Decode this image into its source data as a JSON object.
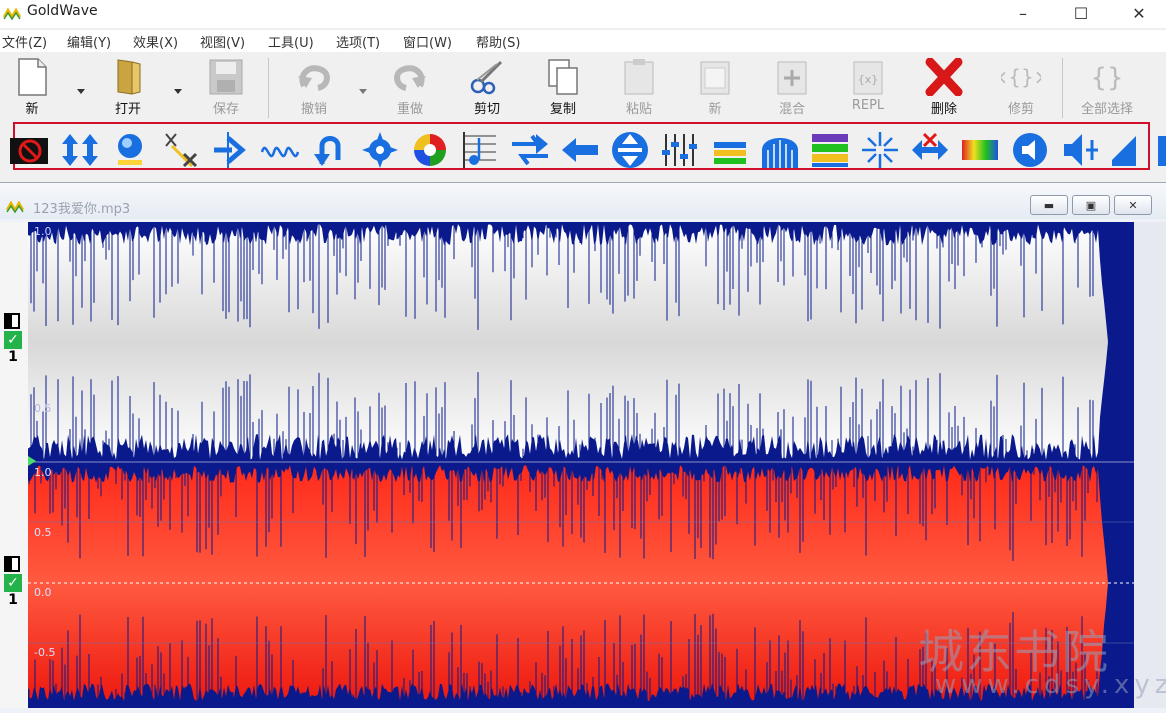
{
  "app": {
    "title": "GoldWave"
  },
  "menu": [
    "文件(Z)",
    "编辑(Y)",
    "效果(X)",
    "视图(V)",
    "工具(U)",
    "选项(T)",
    "窗口(W)",
    "帮助(S)"
  ],
  "toolbar": {
    "new": "新",
    "open": "打开",
    "save": "保存",
    "undo": "撤销",
    "redo": "重做",
    "cut": "剪切",
    "copy": "复制",
    "paste": "粘贴",
    "paste_new": "新",
    "mix": "混合",
    "replace": "REPL",
    "delete": "删除",
    "trim": "修剪",
    "select_all": "全部选择"
  },
  "effects_icons": [
    "stop-icon",
    "volume-updown-icon",
    "echo-icon",
    "remove-icon",
    "pitch-icon",
    "wave-icon",
    "reverse-icon",
    "gear-icon",
    "color-wheel-icon",
    "music-note-icon",
    "arrows-icon",
    "left-arrow-icon",
    "vertical-arrows-icon",
    "equalizer-icon",
    "rainbow-bar-icon",
    "arch-icon",
    "spectrum-icon",
    "burst-icon",
    "crossfade-icon",
    "gradient-icon",
    "speaker-icon",
    "speaker-plus-icon",
    "speaker-ramp-icon"
  ],
  "document": {
    "filename": "123我爱你.mp3",
    "channel_top": {
      "labels": [
        "1.0",
        "0.5"
      ],
      "number": "1"
    },
    "channel_bottom": {
      "labels": [
        "1.0",
        "0.5",
        "0.0",
        "-0.5"
      ],
      "number": "1"
    }
  },
  "colors": {
    "wave_bg": "#0a1a8c",
    "top_fill": "#ffffff",
    "bottom_fill": "#ff1a1a",
    "selection_border": "#d0102a"
  },
  "watermark": {
    "line1": "城东书院",
    "line2": "www.cdsy.xyz"
  }
}
